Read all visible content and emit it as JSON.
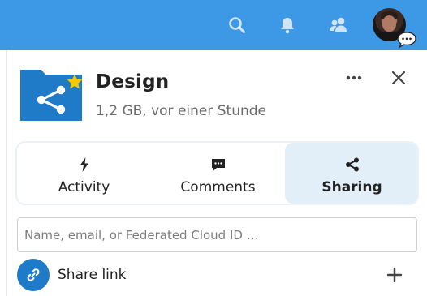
{
  "header": {
    "search_icon": "search-icon",
    "notifications_icon": "bell-icon",
    "contacts_icon": "contacts-icon",
    "avatar": "user-avatar",
    "status_icon": "chat-bubble-icon",
    "background_color": "#3d98e6"
  },
  "file": {
    "name": "Design",
    "meta": "1,2 GB, vor einer Stunde",
    "icon": "shared-folder-icon",
    "favorite_icon": "star-icon",
    "folder_color": "#1f7ac8",
    "star_color": "#f6c800"
  },
  "actions": {
    "more_icon": "more-horizontal-icon",
    "close_icon": "close-icon"
  },
  "tabs": [
    {
      "label": "Activity",
      "icon": "lightning-icon",
      "active": false
    },
    {
      "label": "Comments",
      "icon": "comment-icon",
      "active": false
    },
    {
      "label": "Sharing",
      "icon": "share-icon",
      "active": true
    }
  ],
  "share": {
    "placeholder": "Name, email, or Federated Cloud ID …",
    "value": "",
    "link_label": "Share link",
    "link_icon": "link-icon",
    "add_icon": "plus-icon"
  }
}
